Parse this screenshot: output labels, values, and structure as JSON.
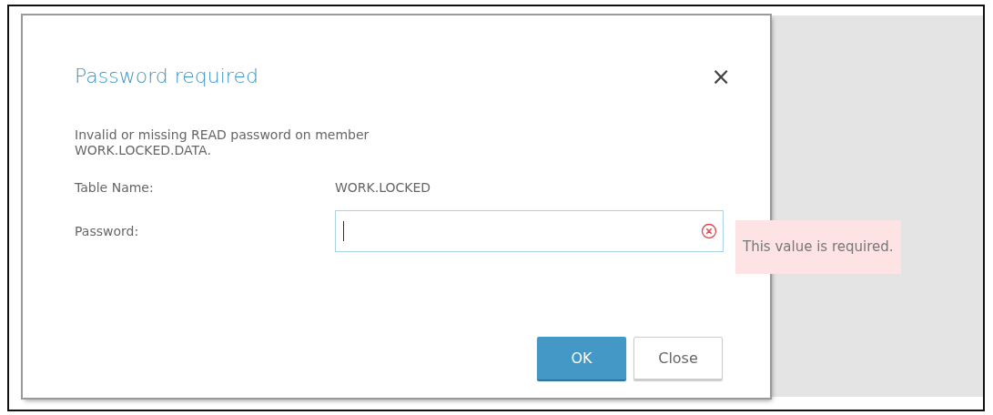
{
  "dialog": {
    "title": "Password required",
    "close": "×",
    "message": "Invalid or missing READ password on member WORK.LOCKED.DATA.",
    "fields": [
      {
        "kind": "text",
        "label": "Table Name:",
        "value": "WORK.LOCKED"
      },
      {
        "kind": "password",
        "label": "Password:",
        "invalid": true,
        "error": "This value is required."
      }
    ],
    "buttons": [
      {
        "label": "OK",
        "primary": true
      },
      {
        "label": "Close",
        "primary": false
      }
    ]
  }
}
